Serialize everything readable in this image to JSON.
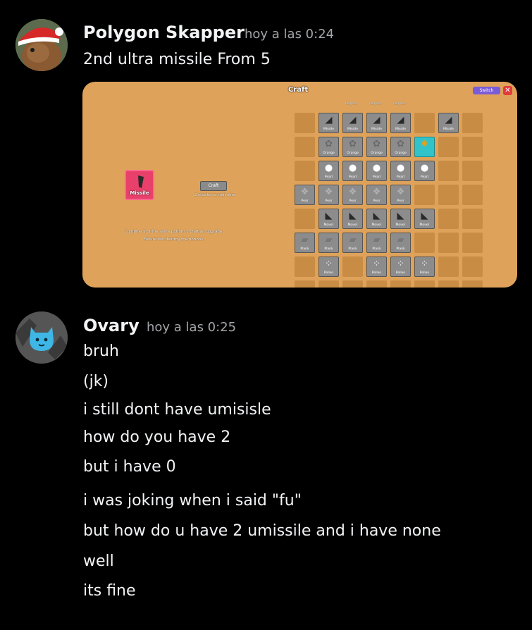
{
  "messages": [
    {
      "author": "Polygon Skapper",
      "timestamp": "hoy a las 0:24",
      "lines": [
        "2nd ultra missile From 5"
      ]
    },
    {
      "author": "Ovary",
      "timestamp": "hoy a las 0:25",
      "lines": [
        "bruh",
        "(jk)",
        "i still dont have umisisle",
        "how do you have 2",
        "but i have 0",
        "i was joking when i said \"fu\"",
        "but how do u have 2 umissile and i have none",
        "well",
        "its fine"
      ]
    }
  ],
  "game": {
    "title": "Craft",
    "switch_label": "Switch",
    "close_glyph": "✕",
    "selected_item": "Missile",
    "craft_button": "Craft",
    "craft_sub": "2 missiles to craft ultra",
    "hint_line1": "Combine 5 of the same potion to craft an upgrade.",
    "hint_line2": "Failure will destroy the potions.",
    "column_heads": [
      "Magnet",
      "Magnet",
      "Magnet"
    ],
    "slot_names": {
      "missile": "Missile",
      "orange": "Orange",
      "pearl": "Pearl",
      "pear": "Pear",
      "mover": "Mover",
      "plank": "Plank",
      "pollen": "Pollen"
    }
  },
  "colors": {
    "background": "#000000",
    "text": "#f2f3f5",
    "timestamp": "#a3a6aa",
    "embed_bg": "#dea25a",
    "missile_card": "#e8406a",
    "switch_button": "#7b5cd8"
  }
}
